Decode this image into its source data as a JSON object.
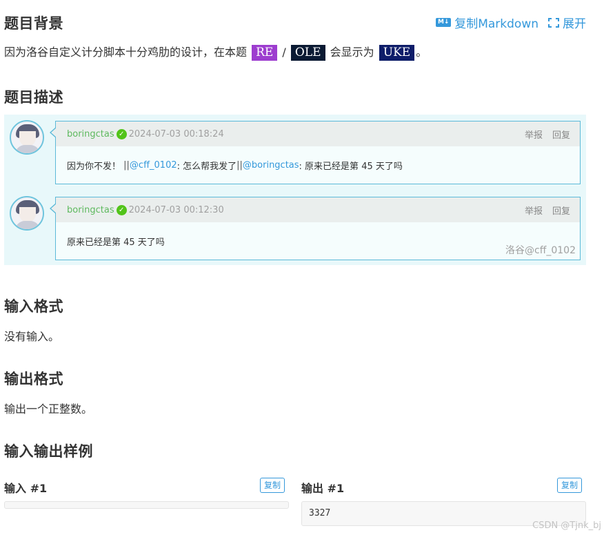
{
  "background": {
    "heading": "题目背景",
    "text_before": "因为洛谷自定义计分脚本十分鸡肋的设计，在本题",
    "badges": [
      "RE",
      "OLE",
      "UKE"
    ],
    "slash": "/",
    "text_middle": "会显示为",
    "text_end": "。"
  },
  "actions": {
    "copy_markdown": "复制Markdown",
    "md_icon": "M↓",
    "expand": "展开"
  },
  "description": {
    "heading": "题目描述",
    "comments": [
      {
        "user": "boringctas",
        "time": "2024-07-03 00:18:24",
        "report": "举报",
        "reply": "回复",
        "body_start": "因为你不发！ ",
        "sep1": "|| ",
        "mention1": "@cff_0102",
        "part1": ": 怎么帮我发了 ",
        "sep2": "|| ",
        "mention2": "@boringctas",
        "part2": ": 原来已经是第 45 天了吗"
      },
      {
        "user": "boringctas",
        "time": "2024-07-03 00:12:30",
        "report": "举报",
        "reply": "回复",
        "body": "原来已经是第 45 天了吗",
        "watermark": "洛谷@cff_0102"
      }
    ]
  },
  "input_format": {
    "heading": "输入格式",
    "text": "没有输入。"
  },
  "output_format": {
    "heading": "输出格式",
    "text": "输出一个正整数。"
  },
  "samples": {
    "heading": "输入输出样例",
    "input_title": "输入 #1",
    "output_title": "输出 #1",
    "copy": "复制",
    "input_value": "",
    "output_value": "3327"
  },
  "footer_watermark": "CSDN @Tjnk_bj",
  "colors": {
    "accent": "#3498db",
    "badge_re": "#9d3dcf",
    "badge_ole": "#0b1a33",
    "badge_uke": "#0e1d69",
    "username": "#5eb95e"
  }
}
